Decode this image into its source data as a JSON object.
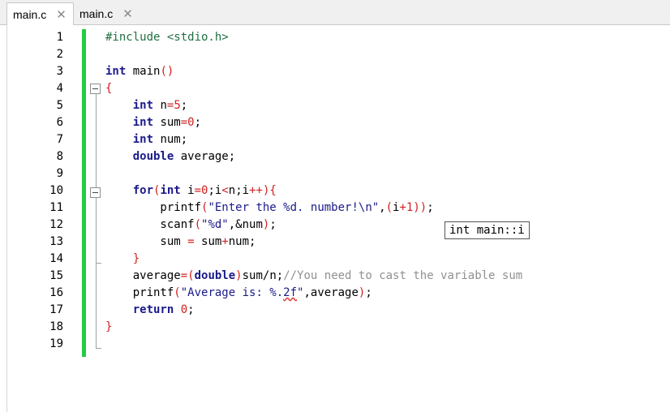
{
  "tabs": [
    {
      "label": "main.c",
      "active": true
    },
    {
      "label": "main.c",
      "active": false
    }
  ],
  "tab_close_glyph": "✕",
  "line_numbers": [
    "1",
    "2",
    "3",
    "4",
    "5",
    "6",
    "7",
    "8",
    "9",
    "10",
    "11",
    "12",
    "13",
    "14",
    "15",
    "16",
    "17",
    "18",
    "19"
  ],
  "tooltip": "int main::i",
  "code_lines": [
    "#include <stdio.h>",
    "",
    "int main()",
    "{",
    "    int n=5;",
    "    int sum=0;",
    "    int num;",
    "    double average;",
    "",
    "    for(int i=0;i<n;i++){",
    "        printf(\"Enter the %d. number!\\n\",(i+1));",
    "        scanf(\"%d\",&num);",
    "        sum = sum+num;",
    "    }",
    "    average=(double)sum/n;//You need to cast the variable sum",
    "    printf(\"Average is: %.2f\",average);",
    "    return 0;",
    "}",
    ""
  ],
  "colors": {
    "change_bar": "#22cc44",
    "keyword": "#1a1a8a",
    "number": "#d02020",
    "comment": "#909090"
  }
}
